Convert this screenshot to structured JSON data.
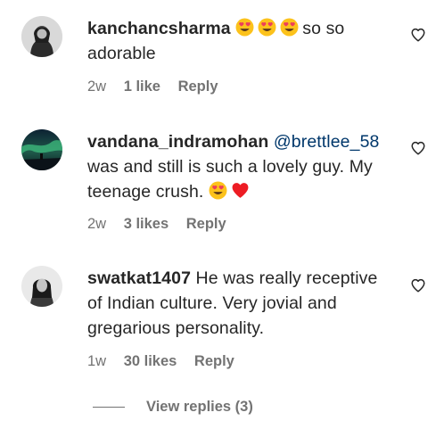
{
  "comments": [
    {
      "username": "kanchancsharma",
      "text_before": "",
      "mention": "",
      "text_after": "so so adorable",
      "emojis": [
        "heart-eyes",
        "heart-eyes",
        "heart-eyes"
      ],
      "trailing_emojis": [],
      "time": "2w",
      "likes": "1 like",
      "reply_label": "Reply"
    },
    {
      "username": "vandana_indramohan",
      "mention": "@brettlee_58",
      "text_after": "was and still is such a lovely guy. My teenage crush.",
      "trailing_emojis": [
        "heart-eyes",
        "red-heart"
      ],
      "time": "2w",
      "likes": "3 likes",
      "reply_label": "Reply"
    },
    {
      "username": "swatkat1407",
      "text_after": "He was really receptive of Indian culture. Very jovial and gregarious personality.",
      "time": "1w",
      "likes": "30 likes",
      "reply_label": "Reply"
    }
  ],
  "view_replies": "View replies (3)",
  "icons": {
    "like": "heart-outline-icon"
  },
  "colors": {
    "text": "#262626",
    "secondary": "#737373",
    "mention": "#00376b",
    "heart_red": "#ed4956"
  }
}
